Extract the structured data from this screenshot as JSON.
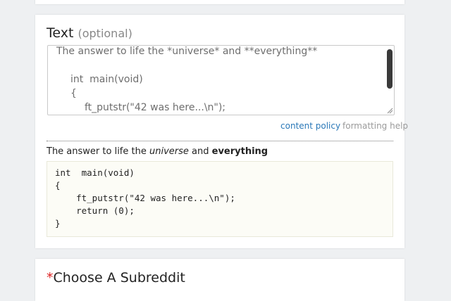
{
  "text_field": {
    "title": "Text",
    "optional_label": "(optional)",
    "lines": [
      "The answer to life the *universe* and **everything**",
      "",
      "int  main(void)",
      "{",
      "ft_putstr(\"42 was here...\\n\");"
    ]
  },
  "links": {
    "content_policy": "content policy",
    "formatting_help": "formatting help"
  },
  "preview": {
    "text_pre": "The answer to life the ",
    "text_em": "universe",
    "text_mid": " and ",
    "text_bold": "everything",
    "code_lines": [
      "int  main(void)",
      "{",
      "    ft_putstr(\"42 was here...\\n\");",
      "    return (0);",
      "}"
    ]
  },
  "subreddit": {
    "required_mark": "*",
    "label": "Choose A Subreddit"
  },
  "colors": {
    "link": "#2a78b8",
    "required": "#d22222"
  },
  "icons": [
    "scrollbar-thumb",
    "resize-grip-icon"
  ]
}
